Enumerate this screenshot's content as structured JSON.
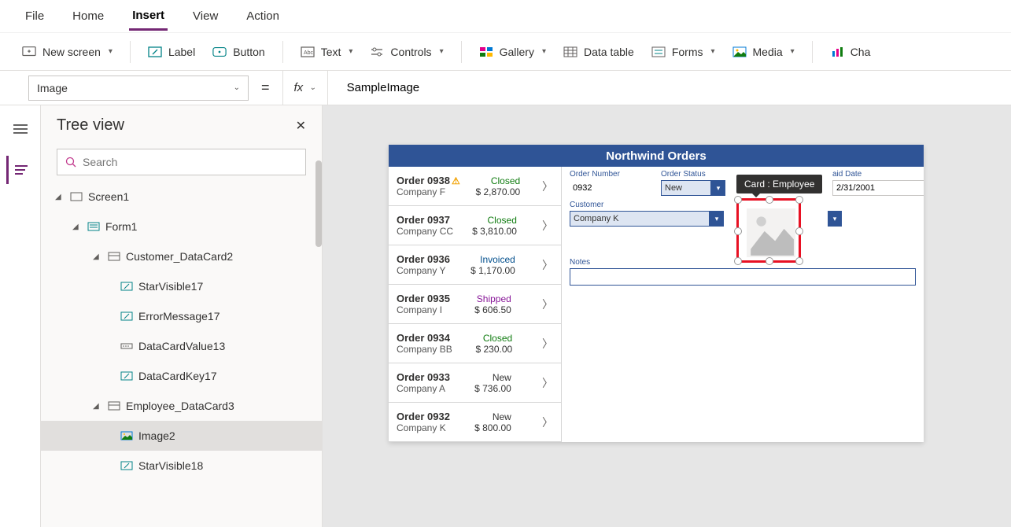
{
  "menubar": {
    "items": [
      "File",
      "Home",
      "Insert",
      "View",
      "Action"
    ],
    "active": "Insert"
  },
  "ribbon": {
    "new_screen": "New screen",
    "label": "Label",
    "button": "Button",
    "text": "Text",
    "controls": "Controls",
    "gallery": "Gallery",
    "data_table": "Data table",
    "forms": "Forms",
    "media": "Media",
    "charts": "Cha"
  },
  "formula": {
    "property": "Image",
    "fx": "fx",
    "value": "SampleImage"
  },
  "tree": {
    "title": "Tree view",
    "search_placeholder": "Search",
    "nodes": {
      "screen1": "Screen1",
      "form1": "Form1",
      "customer_card": "Customer_DataCard2",
      "starvisible17": "StarVisible17",
      "errormessage17": "ErrorMessage17",
      "datacardvalue13": "DataCardValue13",
      "datacardkey17": "DataCardKey17",
      "employee_card": "Employee_DataCard3",
      "image2": "Image2",
      "starvisible18": "StarVisible18"
    }
  },
  "app": {
    "title": "Northwind Orders",
    "orders": [
      {
        "id": "Order 0938",
        "company": "Company F",
        "status": "Closed",
        "status_class": "closed",
        "amount": "$ 2,870.00",
        "warn": true
      },
      {
        "id": "Order 0937",
        "company": "Company CC",
        "status": "Closed",
        "status_class": "closed",
        "amount": "$ 3,810.00",
        "warn": false
      },
      {
        "id": "Order 0936",
        "company": "Company Y",
        "status": "Invoiced",
        "status_class": "invoiced",
        "amount": "$ 1,170.00",
        "warn": false
      },
      {
        "id": "Order 0935",
        "company": "Company I",
        "status": "Shipped",
        "status_class": "shipped",
        "amount": "$ 606.50",
        "warn": false
      },
      {
        "id": "Order 0934",
        "company": "Company BB",
        "status": "Closed",
        "status_class": "closed",
        "amount": "$ 230.00",
        "warn": false
      },
      {
        "id": "Order 0933",
        "company": "Company A",
        "status": "New",
        "status_class": "new",
        "amount": "$ 736.00",
        "warn": false
      },
      {
        "id": "Order 0932",
        "company": "Company K",
        "status": "New",
        "status_class": "new",
        "amount": "$ 800.00",
        "warn": false
      }
    ],
    "detail": {
      "order_number_label": "Order Number",
      "order_number_value": "0932",
      "order_status_label": "Order Status",
      "order_status_value": "New",
      "paid_date_label": "aid Date",
      "paid_date_value": "2/31/2001",
      "customer_label": "Customer",
      "customer_value": "Company K",
      "notes_label": "Notes"
    },
    "tooltip": "Card : Employee"
  }
}
